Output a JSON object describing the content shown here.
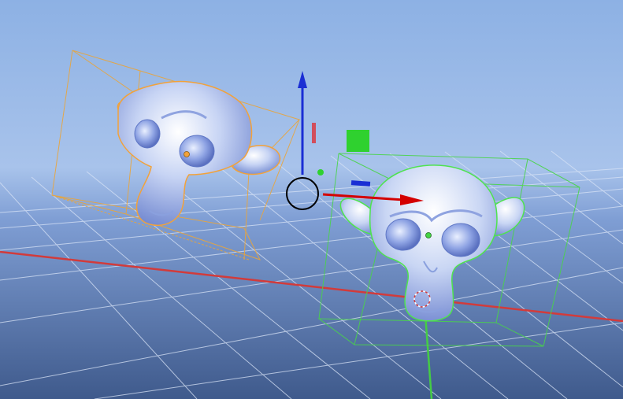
{
  "viewport": {
    "colors": {
      "sky_top": "#8eb2e4",
      "horizon": "#a9c3ea",
      "floor_near": "#3f5a8c",
      "grid_line": "#d6e2f5",
      "x_axis": "#d23b3b",
      "y_axis": "#35c235",
      "selected_outline": "#f2a23a",
      "active_outline": "#4fe34f",
      "gizmo_x": "#d40000",
      "gizmo_y": "#2fd12f",
      "gizmo_z": "#1a2ed4",
      "monkey_fill": "#c9d6f4",
      "monkey_shade": "#7f97d8"
    }
  },
  "objects": [
    {
      "name": "monkey-left",
      "state": "selected",
      "outline": "orange"
    },
    {
      "name": "monkey-right",
      "state": "active",
      "outline": "green"
    }
  ],
  "gizmo": {
    "type": "translate",
    "axes": [
      "x",
      "y",
      "z"
    ],
    "icons": [
      "transform-center-circle-icon",
      "z-arrow-icon",
      "x-arrow-icon",
      "y-plane-handle-icon"
    ]
  },
  "cursor": {
    "icon": "3d-cursor-icon"
  }
}
